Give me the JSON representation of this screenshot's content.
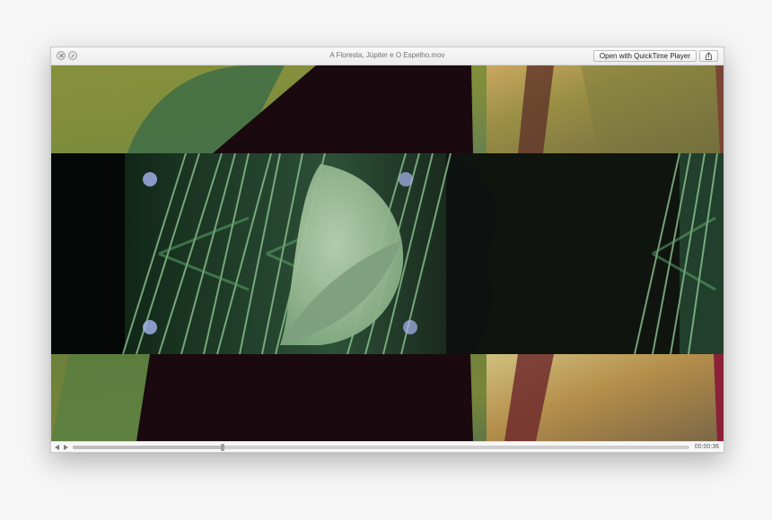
{
  "window": {
    "title": "A Floresta, Júpiter e O Espelho.mov"
  },
  "toolbar": {
    "open_button_label": "Open with QuickTime Player",
    "share_icon": "share-icon"
  },
  "playback": {
    "time_label": "00:00:36",
    "progress_fraction": 0.243
  },
  "colors": {
    "desktop": "#f6f6f6",
    "window_border": "#cfcfcf",
    "video_dark": "#1b090d",
    "video_green": "#7aa07b"
  }
}
